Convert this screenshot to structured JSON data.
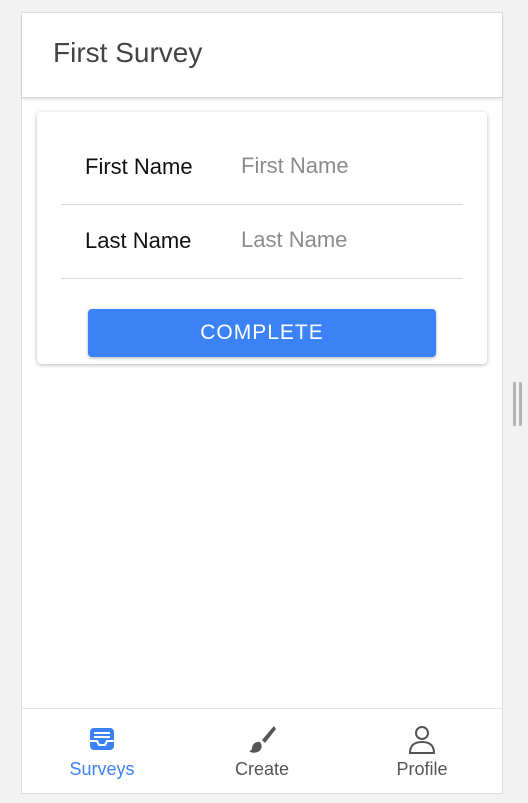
{
  "header": {
    "title": "First Survey"
  },
  "form": {
    "fields": [
      {
        "label": "First Name",
        "placeholder": "First Name",
        "value": ""
      },
      {
        "label": "Last Name",
        "placeholder": "Last Name",
        "value": ""
      }
    ],
    "complete_label": "COMPLETE"
  },
  "tabbar": {
    "tabs": [
      {
        "label": "Surveys",
        "icon": "inbox-icon",
        "active": true
      },
      {
        "label": "Create",
        "icon": "brush-icon",
        "active": false
      },
      {
        "label": "Profile",
        "icon": "person-icon",
        "active": false
      }
    ]
  },
  "colors": {
    "accent": "#3c82f7",
    "inactive": "#555555",
    "header_text": "#444444"
  }
}
